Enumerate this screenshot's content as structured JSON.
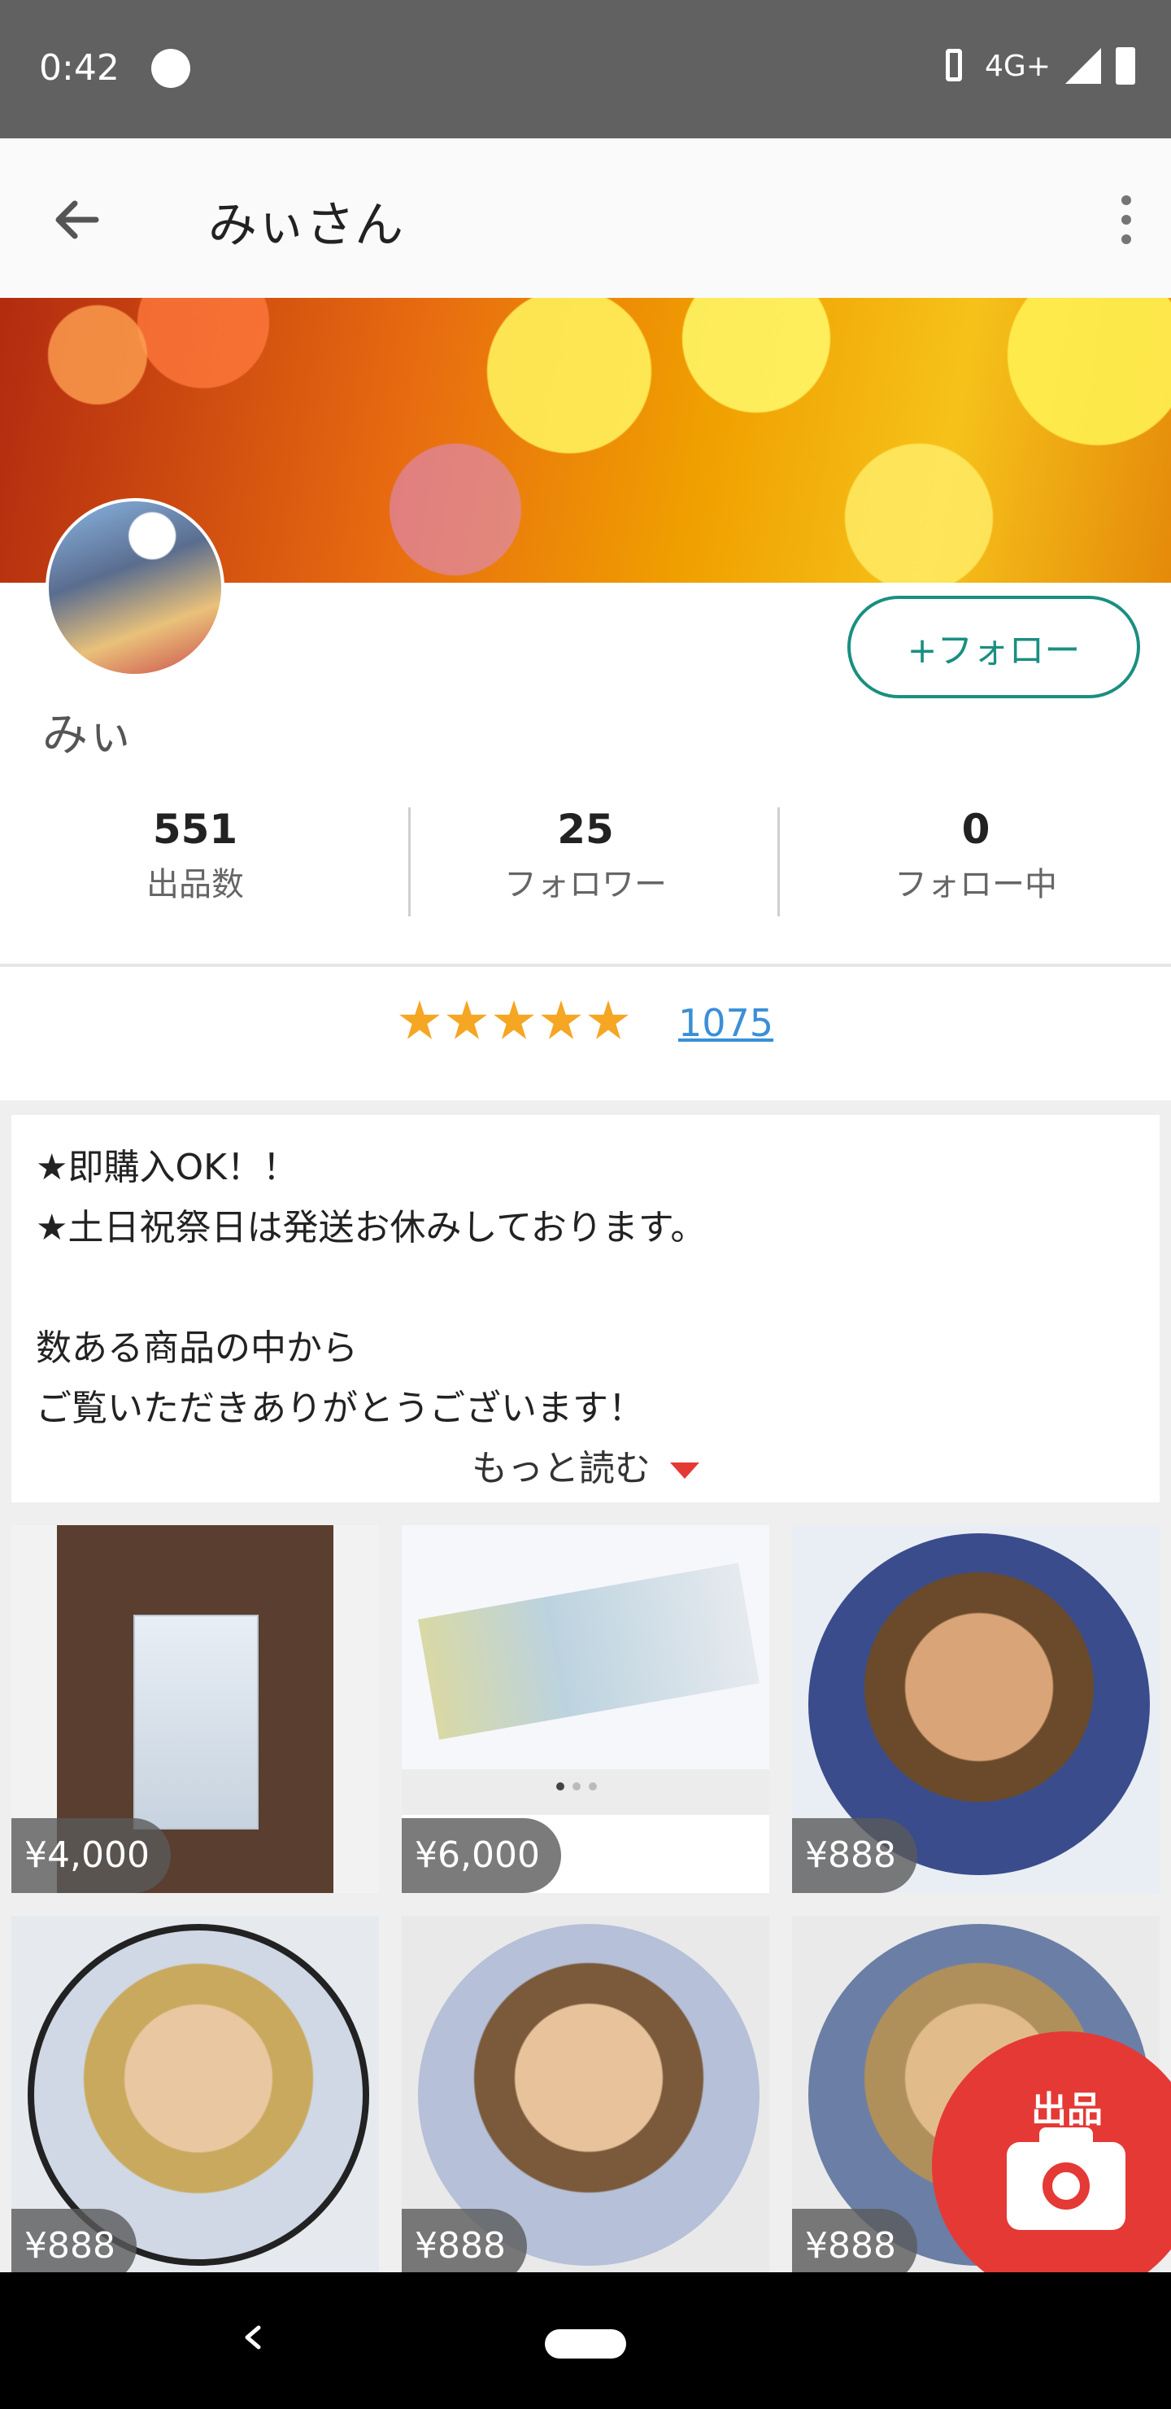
{
  "status_bar": {
    "time": "0:42",
    "network": "4G+"
  },
  "app_bar": {
    "title": "みぃさん"
  },
  "profile": {
    "follow_label": "+フォロー",
    "username": "みぃ",
    "stats": [
      {
        "value": "551",
        "label": "出品数"
      },
      {
        "value": "25",
        "label": "フォロワー"
      },
      {
        "value": "0",
        "label": "フォロー中"
      }
    ]
  },
  "rating": {
    "stars": 5,
    "review_count": "1075"
  },
  "description": {
    "text": "★即購入OK！！\n★土日祝祭日は発送お休みしております。\n\n数ある商品の中から\nご覧いただきありがとうございます！",
    "read_more": "もっと読む"
  },
  "items": [
    {
      "price": "¥4,000"
    },
    {
      "price": "¥6,000"
    },
    {
      "price": "¥888"
    },
    {
      "price": "¥888"
    },
    {
      "price": "¥888"
    },
    {
      "price": "¥888"
    }
  ],
  "fab": {
    "label": "出品"
  },
  "colors": {
    "accent": "#1a8f80",
    "fab": "#e53935",
    "star": "#f5a623",
    "link": "#3b8fd6"
  }
}
